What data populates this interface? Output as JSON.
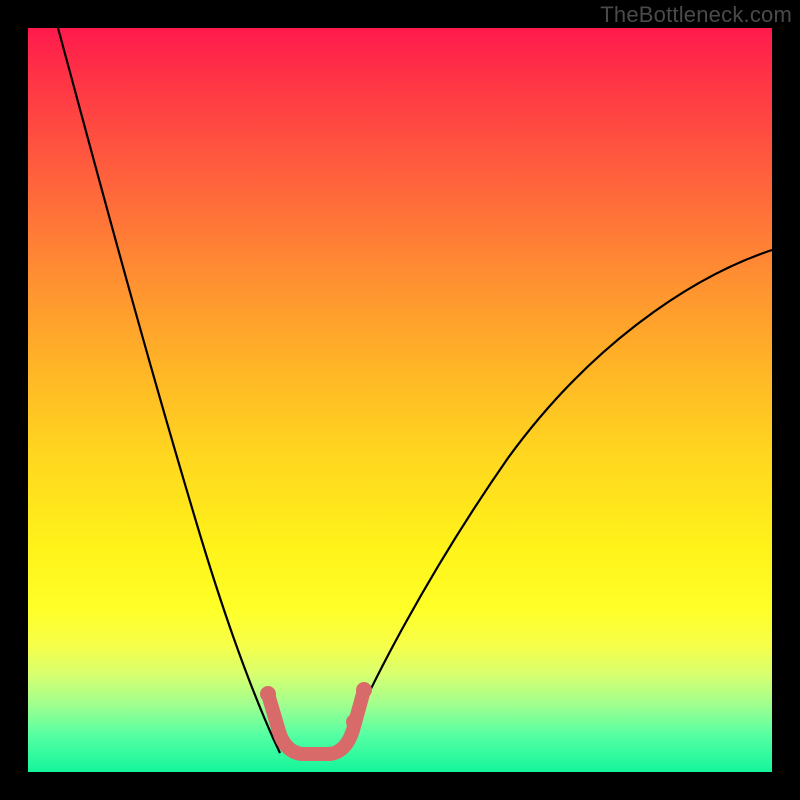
{
  "watermark": "TheBottleneck.com",
  "chart_data": {
    "type": "line",
    "title": "",
    "xlabel": "",
    "ylabel": "",
    "xlim": [
      0,
      100
    ],
    "ylim": [
      0,
      100
    ],
    "grid": false,
    "background": "rainbow-gradient-red-to-green",
    "series": [
      {
        "name": "left-curve",
        "x": [
          4,
          8,
          12,
          16,
          20,
          24,
          28,
          30,
          32,
          33.5
        ],
        "values": [
          100,
          86,
          72,
          58,
          45,
          33,
          22,
          15,
          8,
          3
        ]
      },
      {
        "name": "right-curve",
        "x": [
          42,
          46,
          52,
          60,
          70,
          80,
          90,
          100
        ],
        "values": [
          3,
          10,
          20,
          32,
          46,
          57,
          65,
          70
        ]
      }
    ],
    "markers": {
      "name": "bottom-valley-dots",
      "color": "#d86a6a",
      "points": [
        {
          "x": 32,
          "y": 10
        },
        {
          "x": 33,
          "y": 6
        },
        {
          "x": 34,
          "y": 3
        },
        {
          "x": 36,
          "y": 2
        },
        {
          "x": 38,
          "y": 2
        },
        {
          "x": 40,
          "y": 2
        },
        {
          "x": 42,
          "y": 4
        },
        {
          "x": 43.5,
          "y": 8
        },
        {
          "x": 45,
          "y": 12
        }
      ]
    },
    "annotations": []
  }
}
